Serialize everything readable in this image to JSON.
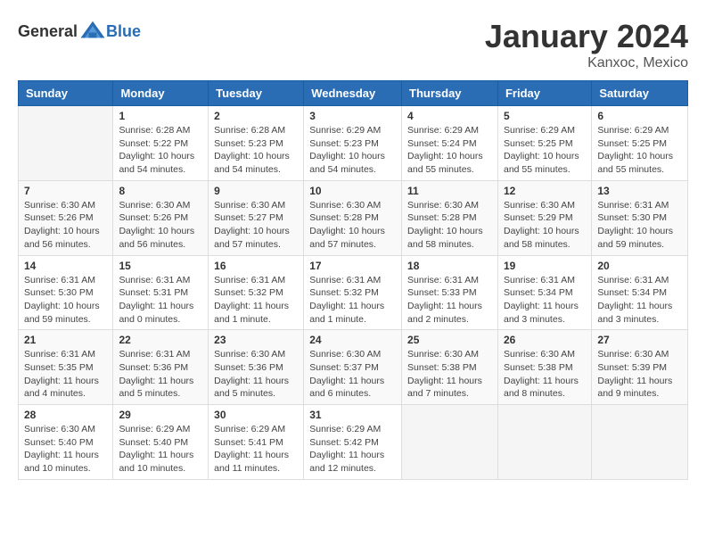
{
  "logo": {
    "text_general": "General",
    "text_blue": "Blue"
  },
  "title": "January 2024",
  "location": "Kanxoc, Mexico",
  "weekdays": [
    "Sunday",
    "Monday",
    "Tuesday",
    "Wednesday",
    "Thursday",
    "Friday",
    "Saturday"
  ],
  "weeks": [
    [
      {
        "day": "",
        "info": ""
      },
      {
        "day": "1",
        "info": "Sunrise: 6:28 AM\nSunset: 5:22 PM\nDaylight: 10 hours\nand 54 minutes."
      },
      {
        "day": "2",
        "info": "Sunrise: 6:28 AM\nSunset: 5:23 PM\nDaylight: 10 hours\nand 54 minutes."
      },
      {
        "day": "3",
        "info": "Sunrise: 6:29 AM\nSunset: 5:23 PM\nDaylight: 10 hours\nand 54 minutes."
      },
      {
        "day": "4",
        "info": "Sunrise: 6:29 AM\nSunset: 5:24 PM\nDaylight: 10 hours\nand 55 minutes."
      },
      {
        "day": "5",
        "info": "Sunrise: 6:29 AM\nSunset: 5:25 PM\nDaylight: 10 hours\nand 55 minutes."
      },
      {
        "day": "6",
        "info": "Sunrise: 6:29 AM\nSunset: 5:25 PM\nDaylight: 10 hours\nand 55 minutes."
      }
    ],
    [
      {
        "day": "7",
        "info": "Sunrise: 6:30 AM\nSunset: 5:26 PM\nDaylight: 10 hours\nand 56 minutes."
      },
      {
        "day": "8",
        "info": "Sunrise: 6:30 AM\nSunset: 5:26 PM\nDaylight: 10 hours\nand 56 minutes."
      },
      {
        "day": "9",
        "info": "Sunrise: 6:30 AM\nSunset: 5:27 PM\nDaylight: 10 hours\nand 57 minutes."
      },
      {
        "day": "10",
        "info": "Sunrise: 6:30 AM\nSunset: 5:28 PM\nDaylight: 10 hours\nand 57 minutes."
      },
      {
        "day": "11",
        "info": "Sunrise: 6:30 AM\nSunset: 5:28 PM\nDaylight: 10 hours\nand 58 minutes."
      },
      {
        "day": "12",
        "info": "Sunrise: 6:30 AM\nSunset: 5:29 PM\nDaylight: 10 hours\nand 58 minutes."
      },
      {
        "day": "13",
        "info": "Sunrise: 6:31 AM\nSunset: 5:30 PM\nDaylight: 10 hours\nand 59 minutes."
      }
    ],
    [
      {
        "day": "14",
        "info": "Sunrise: 6:31 AM\nSunset: 5:30 PM\nDaylight: 10 hours\nand 59 minutes."
      },
      {
        "day": "15",
        "info": "Sunrise: 6:31 AM\nSunset: 5:31 PM\nDaylight: 11 hours\nand 0 minutes."
      },
      {
        "day": "16",
        "info": "Sunrise: 6:31 AM\nSunset: 5:32 PM\nDaylight: 11 hours\nand 1 minute."
      },
      {
        "day": "17",
        "info": "Sunrise: 6:31 AM\nSunset: 5:32 PM\nDaylight: 11 hours\nand 1 minute."
      },
      {
        "day": "18",
        "info": "Sunrise: 6:31 AM\nSunset: 5:33 PM\nDaylight: 11 hours\nand 2 minutes."
      },
      {
        "day": "19",
        "info": "Sunrise: 6:31 AM\nSunset: 5:34 PM\nDaylight: 11 hours\nand 3 minutes."
      },
      {
        "day": "20",
        "info": "Sunrise: 6:31 AM\nSunset: 5:34 PM\nDaylight: 11 hours\nand 3 minutes."
      }
    ],
    [
      {
        "day": "21",
        "info": "Sunrise: 6:31 AM\nSunset: 5:35 PM\nDaylight: 11 hours\nand 4 minutes."
      },
      {
        "day": "22",
        "info": "Sunrise: 6:31 AM\nSunset: 5:36 PM\nDaylight: 11 hours\nand 5 minutes."
      },
      {
        "day": "23",
        "info": "Sunrise: 6:30 AM\nSunset: 5:36 PM\nDaylight: 11 hours\nand 5 minutes."
      },
      {
        "day": "24",
        "info": "Sunrise: 6:30 AM\nSunset: 5:37 PM\nDaylight: 11 hours\nand 6 minutes."
      },
      {
        "day": "25",
        "info": "Sunrise: 6:30 AM\nSunset: 5:38 PM\nDaylight: 11 hours\nand 7 minutes."
      },
      {
        "day": "26",
        "info": "Sunrise: 6:30 AM\nSunset: 5:38 PM\nDaylight: 11 hours\nand 8 minutes."
      },
      {
        "day": "27",
        "info": "Sunrise: 6:30 AM\nSunset: 5:39 PM\nDaylight: 11 hours\nand 9 minutes."
      }
    ],
    [
      {
        "day": "28",
        "info": "Sunrise: 6:30 AM\nSunset: 5:40 PM\nDaylight: 11 hours\nand 10 minutes."
      },
      {
        "day": "29",
        "info": "Sunrise: 6:29 AM\nSunset: 5:40 PM\nDaylight: 11 hours\nand 10 minutes."
      },
      {
        "day": "30",
        "info": "Sunrise: 6:29 AM\nSunset: 5:41 PM\nDaylight: 11 hours\nand 11 minutes."
      },
      {
        "day": "31",
        "info": "Sunrise: 6:29 AM\nSunset: 5:42 PM\nDaylight: 11 hours\nand 12 minutes."
      },
      {
        "day": "",
        "info": ""
      },
      {
        "day": "",
        "info": ""
      },
      {
        "day": "",
        "info": ""
      }
    ]
  ]
}
